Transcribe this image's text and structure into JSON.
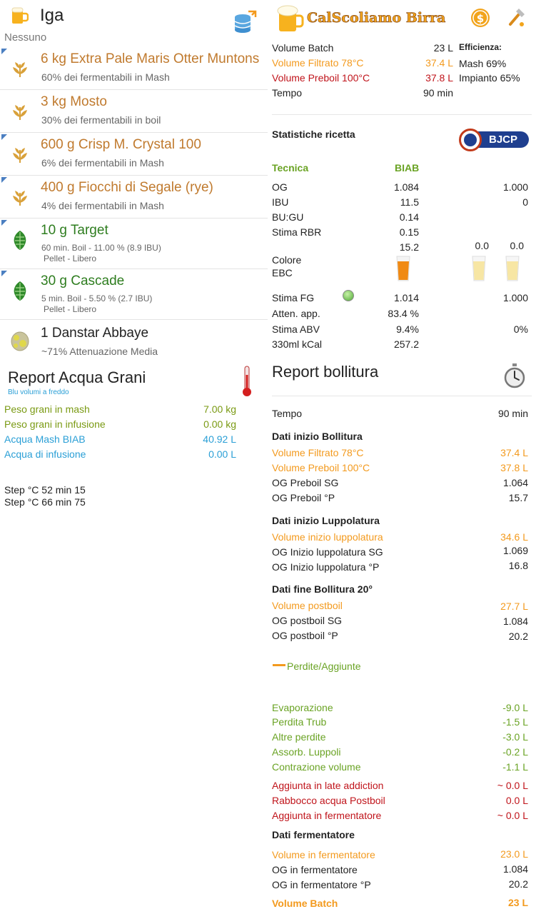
{
  "header": {
    "title": "Iga",
    "subtitle": "Nessuno",
    "logo_text": "CalScoliamo Birra"
  },
  "ingredients": [
    {
      "type": "malt",
      "name": "6 kg Extra Pale Maris Otter Muntons",
      "desc": "60% dei fermentabili in Mash",
      "corner": true
    },
    {
      "type": "malt",
      "name": "3 kg Mosto",
      "desc": "30% dei fermentabili in boil",
      "corner": false
    },
    {
      "type": "malt",
      "name": "600 g Crisp M. Crystal 100",
      "desc": "6% dei fermentabili in Mash",
      "corner": true
    },
    {
      "type": "malt",
      "name": "400 g Fiocchi di Segale (rye)",
      "desc": "4% dei fermentabili in Mash",
      "corner": true
    },
    {
      "type": "hop",
      "name": "10 g Target",
      "desc": "60 min. Boil - 11.00 %  (8.9 IBU)",
      "desc2": "Pellet - Libero",
      "corner": true
    },
    {
      "type": "hop",
      "name": "30 g Cascade",
      "desc": "5 min. Boil - 5.50 %  (2.7 IBU)",
      "desc2": "Pellet - Libero",
      "corner": true
    },
    {
      "type": "yeast",
      "name": "1 Danstar Abbaye",
      "desc": "~71% Attenuazione Media",
      "corner": false
    }
  ],
  "water": {
    "title": "Report Acqua Grani",
    "note": "Blu volumi a freddo",
    "rows": [
      {
        "label": "Peso grani in mash",
        "value": "7.00 kg",
        "color": "olive"
      },
      {
        "label": "Peso grani in infusione",
        "value": "0.00 kg",
        "color": "olive"
      },
      {
        "label": "Acqua Mash BIAB",
        "value": "40.92 L",
        "color": "cyan"
      },
      {
        "label": "Acqua di infusione",
        "value": "0.00 L",
        "color": "cyan"
      }
    ],
    "steps": [
      "Step °C 52 min 15",
      "Step °C 66 min 75"
    ]
  },
  "batch": {
    "rows": [
      {
        "label": "Volume Batch",
        "value": "23 L",
        "color": "dark"
      },
      {
        "label": "Volume Filtrato 78°C",
        "value": "37.4 L",
        "color": "orange"
      },
      {
        "label": "Volume Preboil 100°C",
        "value": "37.8 L",
        "color": "red"
      },
      {
        "label": "Tempo",
        "value": "90 min",
        "color": "dark"
      }
    ],
    "efficiency_title": "Efficienza:",
    "efficiency_mash": "Mash  69%",
    "efficiency_plant": "Impianto  65%"
  },
  "stats": {
    "title": "Statistiche ricetta",
    "bjcp": "BJCP",
    "tecnica_label": "Tecnica",
    "tecnica_value": "BIAB",
    "rows": [
      {
        "label": "OG",
        "v1": "1.084",
        "v3": "1.000"
      },
      {
        "label": "IBU",
        "v1": "11.5",
        "v3": "0"
      },
      {
        "label": "BU:GU",
        "v1": "0.14",
        "v3": ""
      },
      {
        "label": "Stima RBR",
        "v1": "0.15",
        "v3": ""
      }
    ],
    "color_value": "15.2",
    "color_v2": "0.0",
    "color_v3": "0.0",
    "color_label1": "Colore",
    "color_label2": "EBC",
    "rows2": [
      {
        "label": "Stima FG",
        "v1": "1.014",
        "v3": "1.000"
      },
      {
        "label": "Atten. app.",
        "v1": "83.4 %",
        "v3": ""
      },
      {
        "label": "Stima ABV",
        "v1": "9.4%",
        "v3": "0%"
      },
      {
        "label": "330ml kCal",
        "v1": "257.2",
        "v3": ""
      }
    ]
  },
  "boil": {
    "title": "Report bollitura",
    "tempo_label": "Tempo",
    "tempo_value": "90 min",
    "sections": [
      {
        "title": "Dati inizio Bollitura",
        "rows": [
          {
            "label": "Volume Filtrato 78°C",
            "value": "37.4 L",
            "color": "orange"
          },
          {
            "label": "Volume Preboil 100°C",
            "value": "37.8 L",
            "color": "orange"
          },
          {
            "label": "OG Preboil SG",
            "value": "1.064",
            "color": "dark"
          },
          {
            "label": "OG Preboil °P",
            "value": "15.7",
            "color": "dark"
          }
        ]
      },
      {
        "title": "Dati inizio Luppolatura",
        "rows": [
          {
            "label": "Volume inizio luppolatura",
            "value": "34.6 L",
            "color": "orange"
          },
          {
            "label": "OG Inizio luppolatura SG",
            "value": "1.069",
            "color": "dark"
          },
          {
            "label": "OG Inizio luppolatura °P",
            "value": "16.8",
            "color": "dark"
          }
        ]
      },
      {
        "title": "Dati fine Bollitura 20°",
        "rows": [
          {
            "label": "Volume postboil",
            "value": "27.7 L",
            "color": "orange"
          },
          {
            "label": "OG postboil SG",
            "value": "1.084",
            "color": "dark"
          },
          {
            "label": "OG postboil °P",
            "value": "20.2",
            "color": "dark"
          }
        ]
      }
    ],
    "losses_label": "Perdite/Aggiunte",
    "losses": [
      {
        "label": "Evaporazione",
        "value": "-9.0 L",
        "color": "green"
      },
      {
        "label": "Perdita Trub",
        "value": "-1.5 L",
        "color": "green"
      },
      {
        "label": "Altre perdite",
        "value": "-3.0 L",
        "color": "green"
      },
      {
        "label": "Assorb. Luppoli",
        "value": "-0.2 L",
        "color": "green"
      },
      {
        "label": "Contrazione volume",
        "value": "-1.1 L",
        "color": "green"
      }
    ],
    "additions": [
      {
        "label": "Aggiunta in late addiction",
        "value": "~ 0.0 L",
        "color": "red"
      },
      {
        "label": "Rabbocco acqua Postboil",
        "value": "0.0 L",
        "color": "red"
      },
      {
        "label": "Aggiunta in fermentatore",
        "value": "~ 0.0 L",
        "color": "red"
      }
    ],
    "ferm_title": "Dati fermentatore",
    "ferm": [
      {
        "label": "Volume in fermentatore",
        "value": "23.0 L",
        "color": "orange"
      },
      {
        "label": "OG in fermentatore",
        "value": "1.084",
        "color": "dark"
      },
      {
        "label": "OG in fermentatore °P",
        "value": "20.2",
        "color": "dark"
      }
    ],
    "final_label": "Volume Batch",
    "final_value": "23 L"
  },
  "colors": {
    "malt": "#c07a2e",
    "hop": "#2e7d1f",
    "orange": "#f39a1e",
    "red": "#c0141b",
    "green": "#6aa324",
    "cyan": "#2a9fd6",
    "olive": "#7a9a13"
  }
}
